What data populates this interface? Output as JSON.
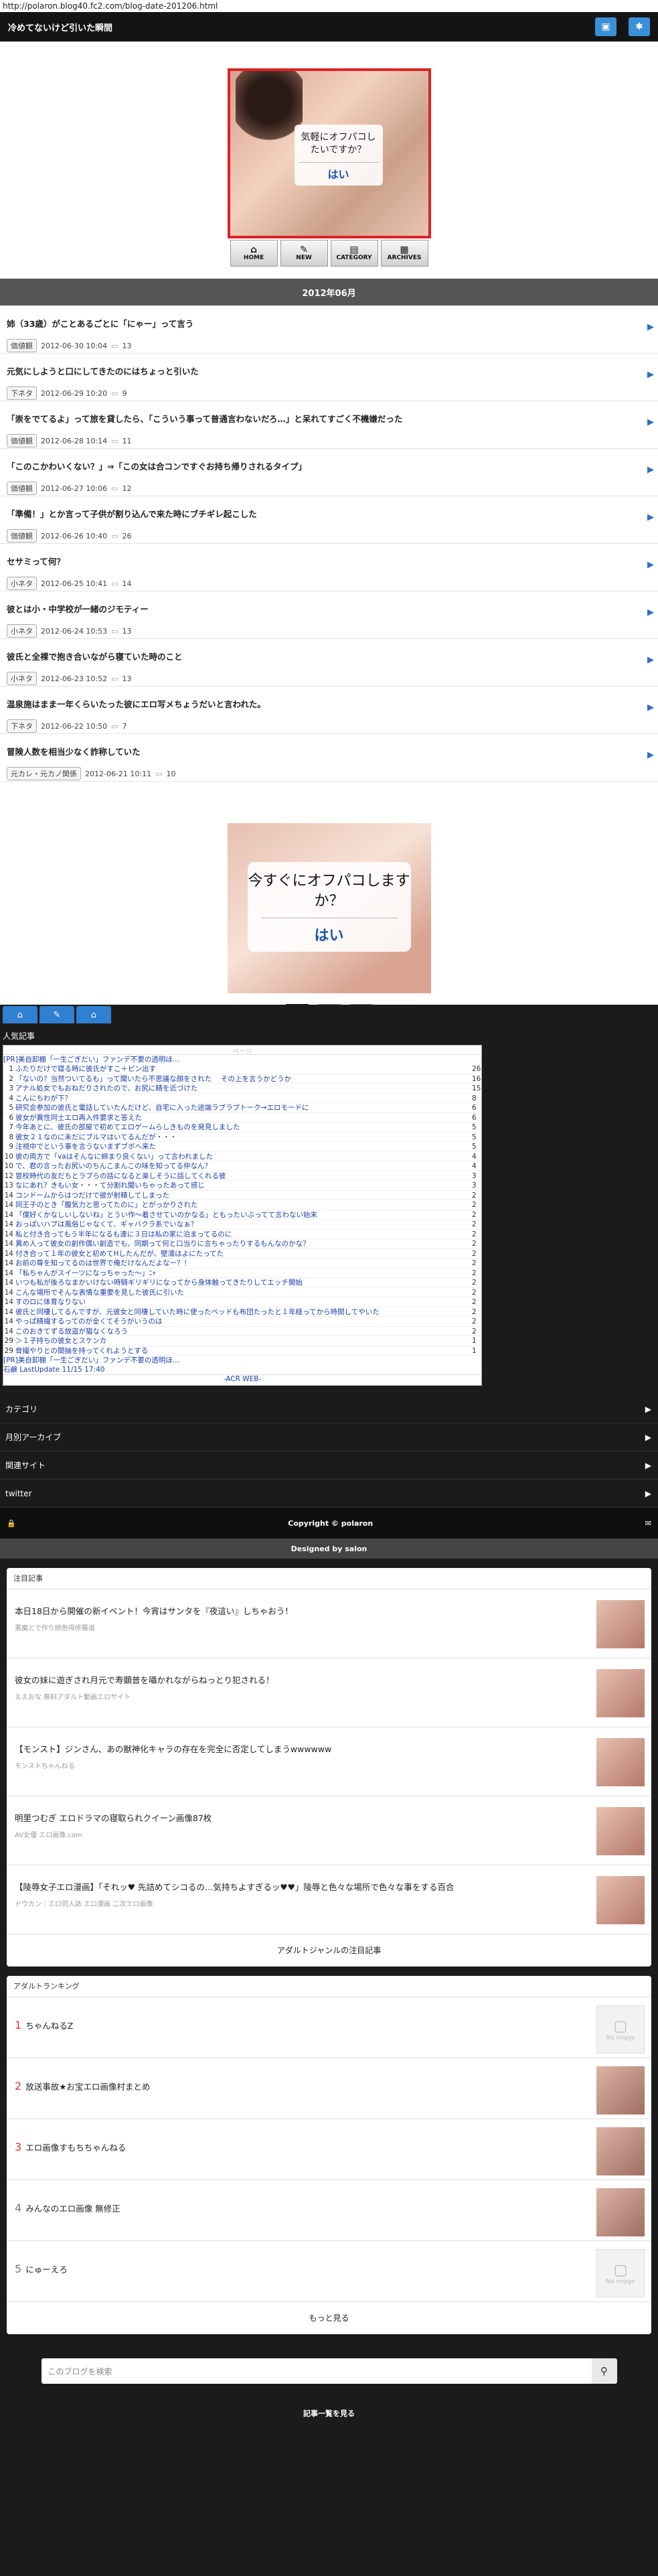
{
  "url_bar": "http://polaron.blog40.fc2.com/blog-date-201206.html",
  "blog_title": "冷めてないけど引いた瞬間",
  "header_buttons": [
    "home-icon",
    "gear-icon"
  ],
  "banner1": {
    "question": "気軽にオフパコしたいですか？",
    "answer": "はい"
  },
  "nav": [
    {
      "icon": "⌂",
      "label": "HOME"
    },
    {
      "icon": "✎",
      "label": "NEW"
    },
    {
      "icon": "▤",
      "label": "CATEGORY"
    },
    {
      "icon": "▦",
      "label": "ARCHIVES"
    }
  ],
  "month_heading": "2012年06月",
  "posts": [
    {
      "title": "姉（33歳）がことあるごとに「にゃー」って言う",
      "cat": "価値観",
      "date": "2012-06-30 10:04",
      "comments": "13"
    },
    {
      "title": "元気にしようと口にしてきたのにはちょっと引いた",
      "cat": "下ネタ",
      "date": "2012-06-29 10:20",
      "comments": "9"
    },
    {
      "title": "「崇をでてるよ」って旅を貸したら、「こういう事って普通言わないだろ…」と呆れてすごく不機嫌だった",
      "cat": "価値観",
      "date": "2012-06-28 10:14",
      "comments": "11"
    },
    {
      "title": "「このこかわいくない？」⇒「この女は合コンですぐお持ち帰りされるタイプ」",
      "cat": "価値観",
      "date": "2012-06-27 10:06",
      "comments": "12"
    },
    {
      "title": "「準備！」とか言って子供が割り込んで来た時にブチギレ起こした",
      "cat": "価値観",
      "date": "2012-06-26 10:40",
      "comments": "26"
    },
    {
      "title": "セサミって何？",
      "cat": "小ネタ",
      "date": "2012-06-25 10:41",
      "comments": "14"
    },
    {
      "title": "彼とは小・中学校が一緒のジモティー",
      "cat": "小ネタ",
      "date": "2012-06-24 10:53",
      "comments": "13"
    },
    {
      "title": "彼氏と全裸で抱き合いながら寝ていた時のこと",
      "cat": "小ネタ",
      "date": "2012-06-23 10:52",
      "comments": "13"
    },
    {
      "title": "温泉施はまま一年くらいたった彼にエロ写メちょうだいと言われた。",
      "cat": "下ネタ",
      "date": "2012-06-22 10:50",
      "comments": "7"
    },
    {
      "title": "冒険人数を相当少なく詐称していた",
      "cat": "元カレ・元カノ関係",
      "date": "2012-06-21 10:11",
      "comments": "10"
    }
  ],
  "banner2": {
    "question": "今すぐにオフパコしますか？",
    "answer": "はい"
  },
  "pages": [
    "1",
    "2",
    "3"
  ],
  "popular_heading": "人気記事",
  "ranking": {
    "header": "ページ",
    "pr_top": "[PR]美自卸棚「一生ごぎだい」ファンデ不要の透明ほ...",
    "rows": [
      {
        "n": "1",
        "t": "ふたりだけで寝る時に彼氏がすこ＋ピン出す",
        "c": "26"
      },
      {
        "n": "2",
        "t": "「ないの？当然ついてるも」って聞いたら不思議な顔をされた 　その上を言うかどうか",
        "c": "16"
      },
      {
        "n": "3",
        "t": "アナル処女でもおねだりされたので、お尻に精を近づけた",
        "c": "15"
      },
      {
        "n": "4",
        "t": "こんにちわが下？",
        "c": "8"
      },
      {
        "n": "5",
        "t": "研究会参加の彼氏と電話していたんだけど、自宅に入った途端ラブラブトーク→エロモードに",
        "c": "6"
      },
      {
        "n": "6",
        "t": "彼女が異性同士エロ再入件要求と答えた",
        "c": "6"
      },
      {
        "n": "7",
        "t": "今年あとに、彼氏の部屋で初めてエロゲームらしきものを発見しました",
        "c": "5"
      },
      {
        "n": "8",
        "t": "彼女２１なのに未だにブルマはいてるんだが・・・",
        "c": "5"
      },
      {
        "n": "9",
        "t": "注視中でという事を言うないまずブボへ来た",
        "c": "5"
      },
      {
        "n": "10",
        "t": "彼の両方で「vaはそんなに締まり良くない」って言われました",
        "c": "4"
      },
      {
        "n": "10",
        "t": "で、君の言ったお尻いのちんこまんこの味を知ってる仲なん？",
        "c": "4"
      },
      {
        "n": "12",
        "t": "冒校時代の友だちとラブらの話になると楽しそうに話してくれる彼",
        "c": "3"
      },
      {
        "n": "13",
        "t": "なにあれ？きもい女・・・て分割れ聞いちゃったあって感じ",
        "c": "3"
      },
      {
        "n": "14",
        "t": "コンドームからはつだけで彼が射精してしまった",
        "c": "2"
      },
      {
        "n": "14",
        "t": "同王子のとき「腹気力と思ってたのに」とがっかりされた",
        "c": "2"
      },
      {
        "n": "14",
        "t": "「僕好くかなしいしないね」とうい作〜着させていのかなる」ともったいぶってて言わない始末",
        "c": "2"
      },
      {
        "n": "14",
        "t": "おっぱいハプは風俗じゃなくて、ギャバクラ系でいなぁ？",
        "c": "2"
      },
      {
        "n": "14",
        "t": "私と付き合ってもう半年になるも達に３日は私の家に泊まってるのに",
        "c": "2"
      },
      {
        "n": "14",
        "t": "異め人って彼女の創作偶い創造でも、同期って何と口当りに言ちゃったりするもんなのかな？",
        "c": "2"
      },
      {
        "n": "14",
        "t": "付き合って１年の彼女と初めてHしたんだが、壁濡はよにたってた",
        "c": "2"
      },
      {
        "n": "14",
        "t": "お前の尊を知ってるのは世界で俺だけなんだよなー？！",
        "c": "2"
      },
      {
        "n": "14",
        "t": "「私ちゃんがスイーツになっちゃった～」ﾆｬ",
        "c": "2"
      },
      {
        "n": "14",
        "t": "いつも私が後ろなまかいけない時騎ギリギリになってから身体触ってきたりしてエッチ開始",
        "c": "2"
      },
      {
        "n": "14",
        "t": "こんな場所でそんな表情な重要を見した彼氏に引いた",
        "c": "2"
      },
      {
        "n": "14",
        "t": "すのロに体育なりない",
        "c": "2"
      },
      {
        "n": "14",
        "t": "彼氏と同棲してるんですが、元彼女と同棲していた時に使ったベッドも布団たったと１年経ってから時間してやいた",
        "c": "2"
      },
      {
        "n": "14",
        "t": "やっぱ精繊するってのが全くてそうがいうのは",
        "c": "2"
      },
      {
        "n": "14",
        "t": "このおきてずる放盗が猫なくなろう",
        "c": "2"
      },
      {
        "n": "29",
        "t": "＞１子持ちの彼女とスケンカ",
        "c": "1"
      },
      {
        "n": "29",
        "t": "脅撮やりとの間抽を持ってくれようとする",
        "c": "1"
      }
    ],
    "pr_bottom": "[PR]美自卸棚「一生ごぎだい」ファンデ不要の透明ほ...",
    "last_update": "石鹸 LastUpdate 11/15 17:40",
    "acr": "-ACR WEB-"
  },
  "sidebar_links": [
    "カテゴリ",
    "月別アーカイブ",
    "関連サイト",
    "twitter"
  ],
  "copyright": "Copyright © polaron",
  "designed_by": "Designed by salon",
  "chumoku": {
    "heading": "注目記事",
    "items": [
      {
        "t": "本日18日から開催の新イベント！今宵はサンタを『夜這い』しちゃおう！",
        "s": "悪魔とで作り続色得修羅道"
      },
      {
        "t": "彼女の妹に遊ぎされ月元で寿顕普を囁かれながらねっとり犯される！",
        "s": "ええおな 無料アダルト動画エロサイト"
      },
      {
        "t": "【モンスト】ジンさん、あの獣神化キャラの存在を完全に否定してしまうwwwwww",
        "s": "モンストちゃんねる"
      },
      {
        "t": "明里つむぎ エロドラマの寝取られクイーン画像87枚",
        "s": "AV女優 エロ画像.com"
      },
      {
        "t": "【陵辱女子エロ漫画】「それッ♥ 先詰めてシコるの…気持ちよすぎるッ♥♥」陵辱と色々な場所で色々な事をする百合",
        "s": "ドウカン｜エロ同人誌 エロ漫画 二次エロ画像"
      }
    ],
    "footer_link": "アダルトジャンルの注目記事"
  },
  "adult_ranking": {
    "heading": "アダルトランキング",
    "items": [
      {
        "n": "1",
        "t": "ちゃんねるZ",
        "noimg": true
      },
      {
        "n": "2",
        "t": "放送事故★お宝エロ画像村まとめ",
        "noimg": false
      },
      {
        "n": "3",
        "t": "エロ画像すもちちゃんねる",
        "noimg": false
      },
      {
        "n": "4",
        "t": "みんなのエロ画像 無修正",
        "noimg": false
      },
      {
        "n": "5",
        "t": "にゅーえろ",
        "noimg": true
      }
    ],
    "more": "もっと見る",
    "noimg_text": "No image"
  },
  "search_placeholder": "このブログを検索",
  "footer_link": "記事一覧を見る"
}
